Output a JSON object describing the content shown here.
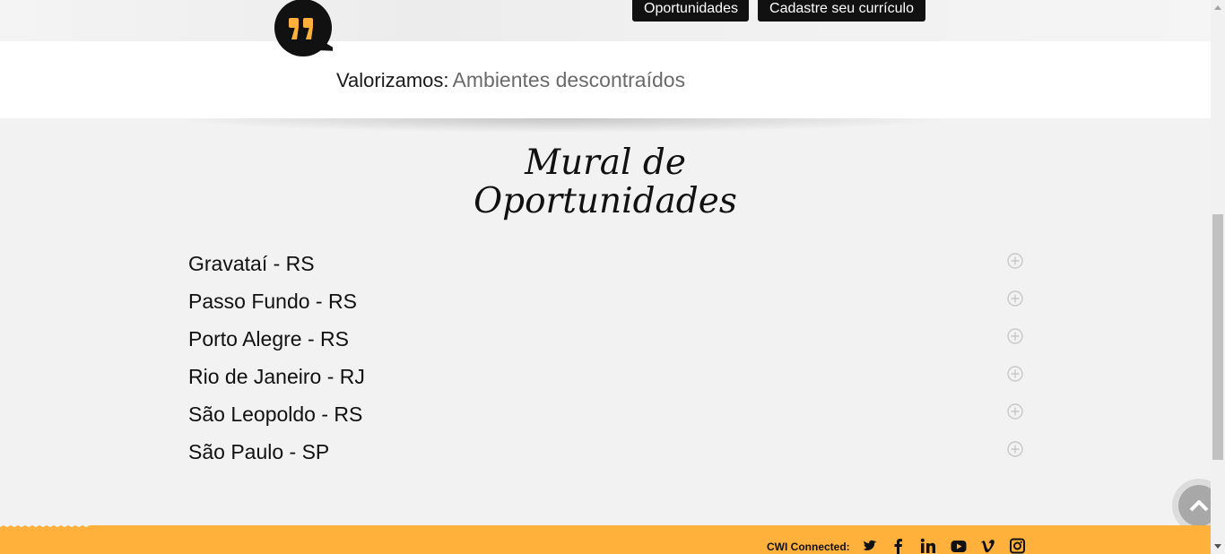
{
  "header": {
    "buttons": {
      "opportunities": "Oportunidades",
      "register_cv": "Cadastre seu currículo"
    }
  },
  "values_strip": {
    "label": "Valorizamos:",
    "value": "Ambientes descontraídos",
    "icon": "quote-icon"
  },
  "section": {
    "title_line1": "Mural de",
    "title_line2": "Oportunidades"
  },
  "locations": [
    {
      "name": "Gravataí - RS"
    },
    {
      "name": "Passo Fundo - RS"
    },
    {
      "name": "Porto Alegre - RS"
    },
    {
      "name": "Rio de Janeiro - RJ"
    },
    {
      "name": "São Leopoldo - RS"
    },
    {
      "name": "São Paulo - SP"
    }
  ],
  "footer": {
    "connected_label": "CWI Connected:",
    "social": [
      "twitter-icon",
      "facebook-icon",
      "linkedin-icon",
      "youtube-icon",
      "vimeo-icon",
      "instagram-icon"
    ]
  },
  "colors": {
    "accent": "#ffb13b",
    "dark": "#111111",
    "background": "#f2f2f2"
  }
}
